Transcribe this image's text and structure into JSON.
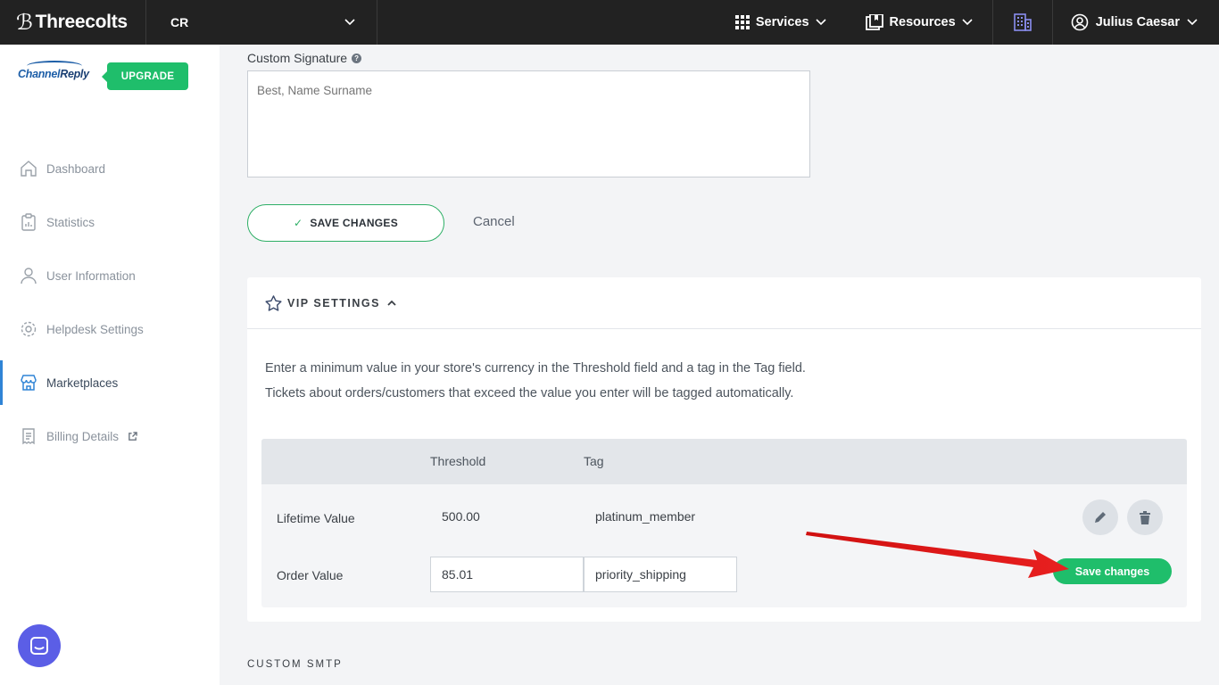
{
  "topbar": {
    "brand": "Threecolts",
    "account": "CR",
    "nav": [
      {
        "label": "Services",
        "icon": "grid-icon"
      },
      {
        "label": "Resources",
        "icon": "book-icon"
      }
    ],
    "user": "Julius Caesar"
  },
  "sidebar": {
    "logo_channel": "Channel",
    "logo_reply": "Reply",
    "upgrade_label": "UPGRADE",
    "items": [
      {
        "label": "Dashboard",
        "icon": "home-icon"
      },
      {
        "label": "Statistics",
        "icon": "clipboard-icon"
      },
      {
        "label": "User Information",
        "icon": "user-icon"
      },
      {
        "label": "Helpdesk Settings",
        "icon": "gear-icon"
      },
      {
        "label": "Marketplaces",
        "icon": "store-icon",
        "active": true
      },
      {
        "label": "Billing Details",
        "icon": "receipt-icon"
      }
    ]
  },
  "signature": {
    "label": "Custom Signature",
    "placeholder": "Best, Name Surname",
    "save_label": "SAVE CHANGES",
    "cancel_label": "Cancel"
  },
  "vip": {
    "title": "VIP SETTINGS",
    "desc1": "Enter a minimum value in your store's currency in the Threshold field and a tag in the Tag field.",
    "desc2": "Tickets about orders/customers that exceed the value you enter will be tagged automatically.",
    "col_threshold": "Threshold",
    "col_tag": "Tag",
    "row1": {
      "label": "Lifetime Value",
      "threshold": "500.00",
      "tag": "platinum_member"
    },
    "row2": {
      "label": "Order Value",
      "threshold": "85.01",
      "tag": "priority_shipping"
    },
    "save_label": "Save changes"
  },
  "smtp_title": "CUSTOM SMTP",
  "colors": {
    "accent": "#1fbe6b",
    "topbar": "#222222",
    "active": "#2f84d6",
    "arrow": "#e01414"
  }
}
